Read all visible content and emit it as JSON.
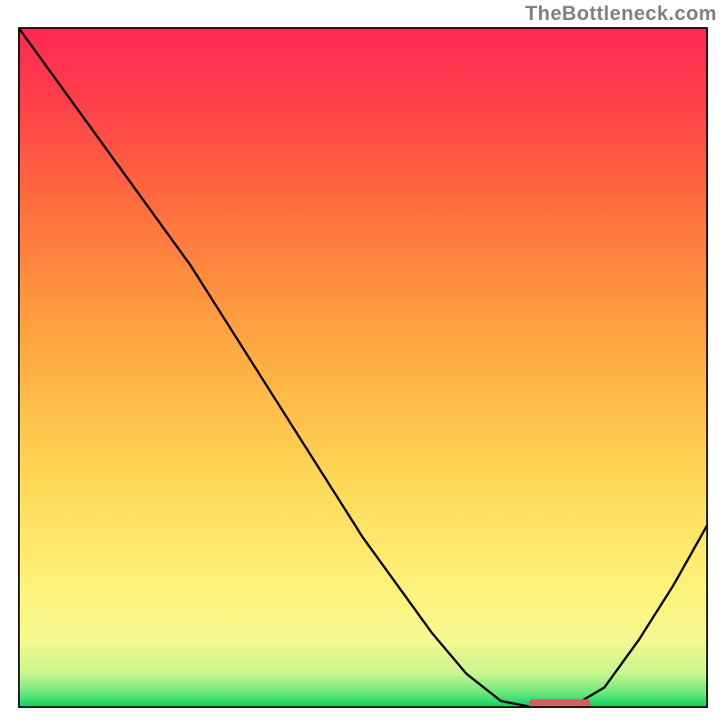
{
  "watermark": "TheBottleneck.com",
  "chart_data": {
    "type": "line",
    "title": "",
    "xlabel": "",
    "ylabel": "",
    "xlim": [
      0,
      100
    ],
    "ylim": [
      0,
      100
    ],
    "x": [
      0,
      5,
      10,
      15,
      20,
      25,
      30,
      35,
      40,
      45,
      50,
      55,
      60,
      65,
      70,
      75,
      80,
      85,
      90,
      95,
      100
    ],
    "values": [
      100,
      93,
      86,
      79,
      72,
      65,
      57,
      49,
      41,
      33,
      25,
      18,
      11,
      5,
      1,
      0,
      0,
      3,
      10,
      18,
      27
    ],
    "optimal_range_x": [
      74,
      83
    ],
    "background_gradient_stops": [
      {
        "offset": 0.0,
        "color": "#00d060"
      },
      {
        "offset": 0.02,
        "color": "#62e67a"
      },
      {
        "offset": 0.05,
        "color": "#c8f58e"
      },
      {
        "offset": 0.1,
        "color": "#f5f88f"
      },
      {
        "offset": 0.18,
        "color": "#fff27a"
      },
      {
        "offset": 0.35,
        "color": "#ffd452"
      },
      {
        "offset": 0.55,
        "color": "#ffa340"
      },
      {
        "offset": 0.75,
        "color": "#ff6a3e"
      },
      {
        "offset": 0.9,
        "color": "#ff3d4a"
      },
      {
        "offset": 1.0,
        "color": "#ff2854"
      }
    ],
    "colors": {
      "line": "#000000",
      "marker": "#d06060",
      "axis": "#000000"
    }
  }
}
